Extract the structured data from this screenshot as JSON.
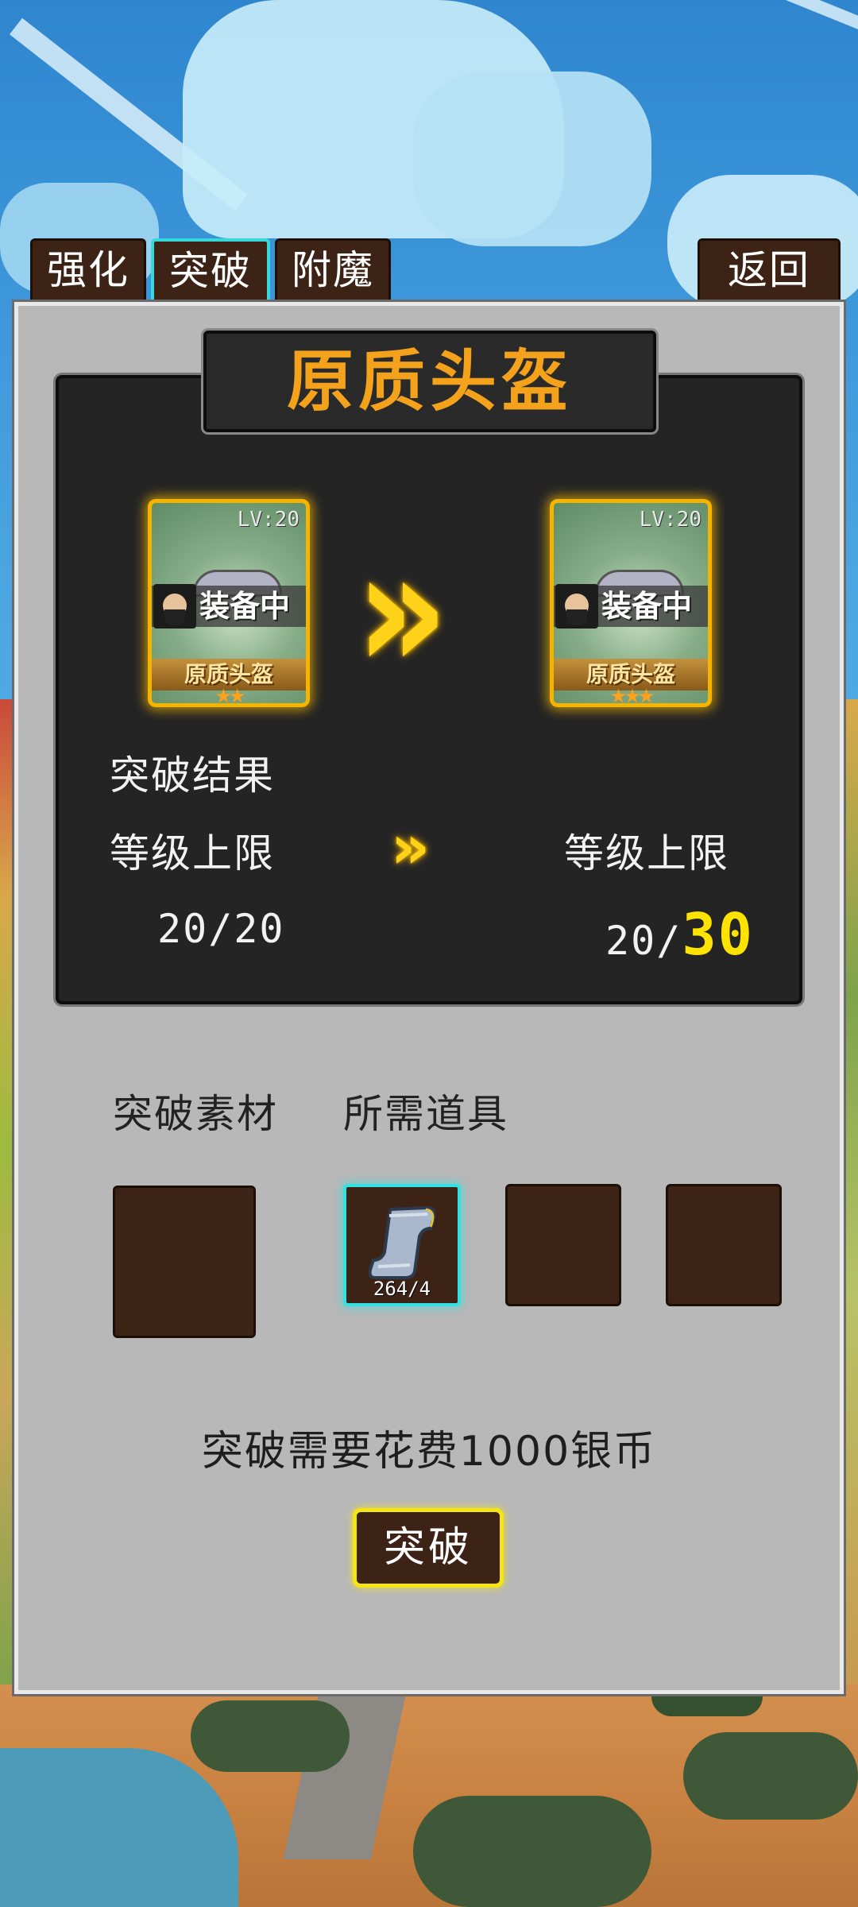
{
  "tabs": [
    {
      "label": "强化",
      "active": false
    },
    {
      "label": "突破",
      "active": true
    },
    {
      "label": "附魔",
      "active": false
    }
  ],
  "back_label": "返回",
  "item_title": "原质头盔",
  "cards": {
    "before": {
      "level": "LV:20",
      "status": "装备中",
      "name": "原质头盔",
      "stars": 2,
      "star_glyphs": "★★"
    },
    "after": {
      "level": "LV:20",
      "status": "装备中",
      "name": "原质头盔",
      "stars": 3,
      "star_glyphs": "★★★"
    }
  },
  "result_label": "突破结果",
  "level_cap": {
    "label_before": "等级上限",
    "label_after": "等级上限",
    "before": "20/20",
    "after_prefix": "20/",
    "after_new": "30"
  },
  "materials": {
    "label_material": "突破素材",
    "label_items": "所需道具",
    "required_item": {
      "icon": "scroll-icon",
      "count": "264/4"
    }
  },
  "cost_text": "突破需要花费1000银币",
  "action_button": "突破",
  "colors": {
    "accent_gold": "#f4a21b",
    "highlight_yellow": "#ffe300",
    "selected_cyan": "#35d9d9",
    "slot_brown": "#3d2316",
    "panel_gray": "#b8b8b8",
    "dark_box": "#242424"
  }
}
